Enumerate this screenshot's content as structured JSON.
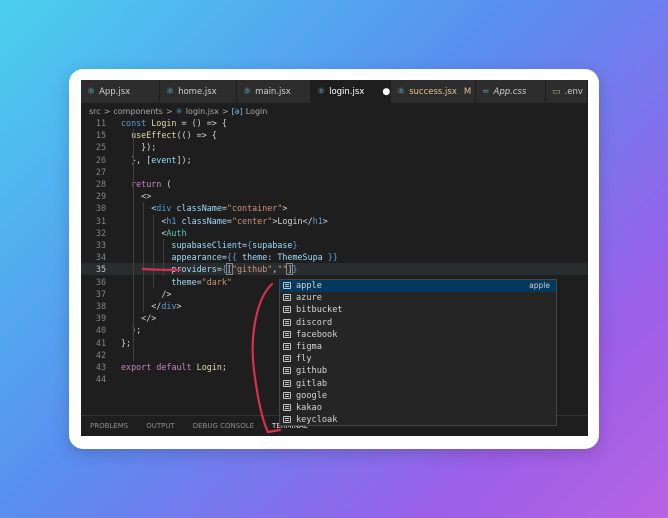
{
  "tabs": [
    {
      "label": "App.jsx",
      "icon": "react-icon",
      "style": ""
    },
    {
      "label": "home.jsx",
      "icon": "react-icon",
      "style": ""
    },
    {
      "label": "main.jsx",
      "icon": "react-icon",
      "style": ""
    },
    {
      "label": "login.jsx",
      "icon": "react-icon",
      "style": "active",
      "unsaved": "●"
    },
    {
      "label": "success.jsx",
      "icon": "react-icon",
      "style": "mod",
      "badge": "M"
    },
    {
      "label": "App.css",
      "icon": "css-icon",
      "style": "it"
    },
    {
      "label": ".env",
      "icon": "env-file-icon",
      "style": ""
    }
  ],
  "breadcrumb": {
    "src": "src",
    "sep": ">",
    "components": "components",
    "file": "login.jsx",
    "symbol": "Login"
  },
  "code": {
    "lines": [
      {
        "num": "11",
        "tokens": [
          [
            "const ",
            "kb"
          ],
          [
            "Login",
            "fn"
          ],
          [
            " = () => {",
            "plain"
          ]
        ]
      },
      {
        "num": "15",
        "tokens": [
          [
            "  ",
            "plain"
          ],
          [
            "useEffect",
            "fn"
          ],
          [
            "(() => {",
            "plain"
          ]
        ]
      },
      {
        "num": "25",
        "tokens": [
          [
            "    });",
            "plain"
          ]
        ]
      },
      {
        "num": "26",
        "tokens": [
          [
            "  }, [",
            "plain"
          ],
          [
            "event",
            "var"
          ],
          [
            "]);",
            "plain"
          ]
        ]
      },
      {
        "num": "27",
        "tokens": []
      },
      {
        "num": "28",
        "tokens": [
          [
            "  ",
            "plain"
          ],
          [
            "return",
            "kw"
          ],
          [
            " (",
            "plain"
          ]
        ]
      },
      {
        "num": "29",
        "tokens": [
          [
            "    <>",
            "plain"
          ]
        ]
      },
      {
        "num": "30",
        "tokens": [
          [
            "      <",
            "plain"
          ],
          [
            "div",
            "tag"
          ],
          [
            " ",
            "plain"
          ],
          [
            "className",
            "attr"
          ],
          [
            "=",
            "plain"
          ],
          [
            "\"container\"",
            "str"
          ],
          [
            ">",
            "plain"
          ]
        ]
      },
      {
        "num": "31",
        "tokens": [
          [
            "        <",
            "plain"
          ],
          [
            "h1",
            "tag"
          ],
          [
            " ",
            "plain"
          ],
          [
            "className",
            "attr"
          ],
          [
            "=",
            "plain"
          ],
          [
            "\"center\"",
            "str"
          ],
          [
            ">Login</",
            "plain"
          ],
          [
            "h1",
            "tag"
          ],
          [
            ">",
            "plain"
          ]
        ]
      },
      {
        "num": "32",
        "tokens": [
          [
            "        <",
            "plain"
          ],
          [
            "Auth",
            "comp"
          ]
        ]
      },
      {
        "num": "33",
        "tokens": [
          [
            "          ",
            "plain"
          ],
          [
            "supabaseClient",
            "attr"
          ],
          [
            "=",
            "plain"
          ],
          [
            "{",
            "kb"
          ],
          [
            "supabase",
            "var"
          ],
          [
            "}",
            "kb"
          ]
        ]
      },
      {
        "num": "34",
        "tokens": [
          [
            "          ",
            "plain"
          ],
          [
            "appearance",
            "attr"
          ],
          [
            "=",
            "plain"
          ],
          [
            "{{ ",
            "kb"
          ],
          [
            "theme",
            "var"
          ],
          [
            ": ",
            "plain"
          ],
          [
            "ThemeSupa",
            "var"
          ],
          [
            " }}",
            "kb"
          ]
        ]
      },
      {
        "num": "35",
        "tokens": [
          [
            "          ",
            "plain"
          ],
          [
            "providers",
            "attr"
          ],
          [
            "=",
            "plain"
          ],
          [
            "{",
            "kb"
          ],
          [
            "[",
            "brkt"
          ],
          [
            "\"github\"",
            "str"
          ],
          [
            ",",
            "plain"
          ],
          [
            "\"\"",
            "str"
          ],
          [
            "]",
            "brkt"
          ],
          [
            "}",
            "kb"
          ]
        ],
        "current": true
      },
      {
        "num": "36",
        "tokens": [
          [
            "          ",
            "plain"
          ],
          [
            "theme",
            "attr"
          ],
          [
            "=",
            "plain"
          ],
          [
            "\"dark\"",
            "str"
          ]
        ]
      },
      {
        "num": "37",
        "tokens": [
          [
            "        />",
            "plain"
          ]
        ]
      },
      {
        "num": "38",
        "tokens": [
          [
            "      </",
            "plain"
          ],
          [
            "div",
            "tag"
          ],
          [
            ">",
            "plain"
          ]
        ]
      },
      {
        "num": "39",
        "tokens": [
          [
            "    </>",
            "plain"
          ]
        ]
      },
      {
        "num": "40",
        "tokens": [
          [
            "  );",
            "plain"
          ]
        ]
      },
      {
        "num": "41",
        "tokens": [
          [
            "};",
            "plain"
          ]
        ]
      },
      {
        "num": "42",
        "tokens": []
      },
      {
        "num": "43",
        "tokens": [
          [
            "export",
            "kw"
          ],
          [
            " ",
            "plain"
          ],
          [
            "default",
            "kw"
          ],
          [
            " ",
            "plain"
          ],
          [
            "Login",
            "fn"
          ],
          [
            ";",
            "plain"
          ]
        ]
      },
      {
        "num": "44",
        "tokens": []
      }
    ]
  },
  "suggest": {
    "items": [
      "apple",
      "azure",
      "bitbucket",
      "discord",
      "facebook",
      "figma",
      "fly",
      "github",
      "gitlab",
      "google",
      "kakao",
      "keycloak"
    ],
    "selected_detail": "apple"
  },
  "panel": {
    "tabs": [
      "PROBLEMS",
      "OUTPUT",
      "DEBUG CONSOLE",
      "TERMINAL"
    ]
  },
  "colors": {
    "annotation": "#d7314a",
    "selection": "#04395e"
  }
}
